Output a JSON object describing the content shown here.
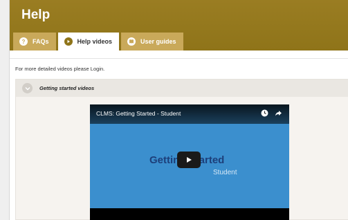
{
  "header": {
    "title": "Help"
  },
  "tabs": [
    {
      "label": "FAQs",
      "icon": "question-icon",
      "active": false
    },
    {
      "label": "Help videos",
      "icon": "play-icon",
      "active": true
    },
    {
      "label": "User guides",
      "icon": "book-icon",
      "active": false
    }
  ],
  "note": "For more detailed videos please Login.",
  "section": {
    "title": "Getting started videos"
  },
  "video": {
    "title": "CLMS: Getting Started - Student",
    "slide_title": "Getting Started",
    "slide_subtitle": "Student"
  },
  "colors": {
    "header": "#8f7419",
    "tab": "#c9a95a",
    "video_bg": "#3b8fce"
  }
}
